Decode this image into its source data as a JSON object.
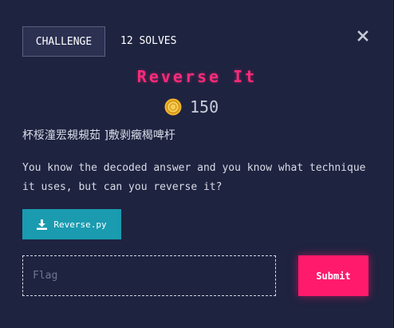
{
  "tabs": {
    "challenge_label": "CHALLENGE",
    "solves_label": "12 SOLVES"
  },
  "challenge": {
    "title": "Reverse It",
    "points": "150",
    "tags_text": "杯桵潼䍔䙻䙻茹 ]敷剥癥楬啤杅",
    "description": "You know the decoded answer and you know what technique it uses, but can you reverse it?"
  },
  "download": {
    "label": "Reverse.py"
  },
  "flag_input": {
    "placeholder": "Flag",
    "value": ""
  },
  "submit": {
    "label": "Submit"
  },
  "colors": {
    "background": "#1e2340",
    "title_pink": "#ff2a7a",
    "download_teal": "#1a9bb0",
    "submit_pink": "#ff1a6c",
    "coin_gold": "#f0b429"
  },
  "icons": {
    "close": "close-icon",
    "coin": "coin-icon",
    "download": "download-icon"
  }
}
